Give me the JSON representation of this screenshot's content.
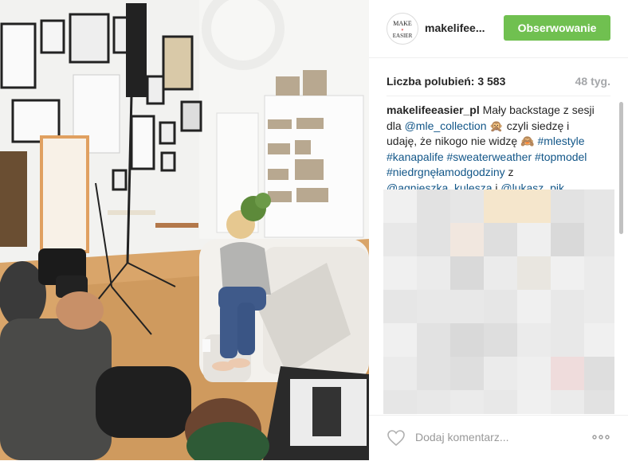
{
  "post": {
    "username": "makelifee...",
    "follow_label": "Obserwowanie",
    "likes_text": "Liczba polubień: 3 583",
    "age": "48 tyg.",
    "caption": {
      "author": "makelifeeasier_pl",
      "line1": " Mały backstage z sesji",
      "line2a": "dla ",
      "mention1": "@mle_collection",
      "line2b": " 🙊 czyli siedzę i",
      "line3": "udaję, że nikogo nie widzę 🙈 ",
      "tag1": "#mlestyle",
      "tag2": "#kanapalife",
      "tag3": "#sweaterweather",
      "tag4": "#topmodel",
      "tag5": "#niedrgnęłamodgodziny",
      "z": " z",
      "mention2": "@agnieszka_kulesza",
      "i": " i ",
      "mention3": "@lukasz_pik"
    },
    "add_comment_placeholder": "Dodaj komentarz...",
    "avatar_text_top": "MAKE",
    "avatar_text_bottom": "EASIER"
  },
  "colors": {
    "follow_green": "#70c050",
    "link_blue": "#125688",
    "muted_gray": "#a5a7aa"
  },
  "icons": [
    "heart-icon",
    "more-options-icon"
  ]
}
